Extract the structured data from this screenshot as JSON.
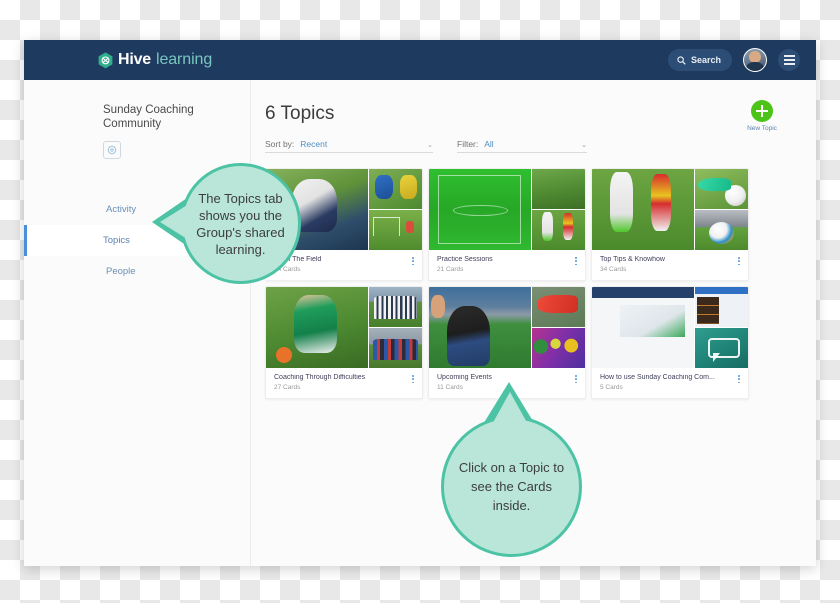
{
  "window": {
    "topbar": {
      "logo_hive": "Hive",
      "logo_learning": "learning",
      "logo_icon": "hive-hexagon-icon",
      "search_label": "Search",
      "search_icon": "search-icon",
      "avatar_name": "user-avatar",
      "menu_icon": "hamburger-menu-icon",
      "bg_color": "#1f3a5f",
      "accent_color": "#79c6c0"
    },
    "sidebar": {
      "group_name": "Sunday Coaching Community",
      "settings_icon": "gear-icon",
      "items": [
        {
          "label": "Activity",
          "active": false
        },
        {
          "label": "Topics",
          "active": true
        },
        {
          "label": "People",
          "active": false
        }
      ],
      "active_color": "#4a90d9"
    },
    "main": {
      "page_title": "6 Topics",
      "new_topic": {
        "label": "New Topic",
        "icon": "plus-icon",
        "color": "#4cc417"
      },
      "sort": {
        "label": "Sort by:",
        "value": "Recent",
        "chevron": "⌄"
      },
      "filter": {
        "label": "Filter:",
        "value": "All",
        "chevron": "⌄"
      },
      "cards": [
        {
          "title": "From The Field",
          "count": "24 Cards",
          "kebab": "more-options-icon"
        },
        {
          "title": "Practice Sessions",
          "count": "21 Cards",
          "kebab": "more-options-icon"
        },
        {
          "title": "Top Tips & Knowhow",
          "count": "34 Cards",
          "kebab": "more-options-icon"
        },
        {
          "title": "Coaching Through Difficulties",
          "count": "27 Cards",
          "kebab": "more-options-icon"
        },
        {
          "title": "Upcoming Events",
          "count": "11 Cards",
          "kebab": "more-options-icon"
        },
        {
          "title": "How to use Sunday Coaching Com...",
          "count": "5 Cards",
          "kebab": "more-options-icon"
        }
      ]
    },
    "callouts": [
      {
        "text": "The Topics tab shows you the Group's shared learning."
      },
      {
        "text": "Click on a Topic to see the Cards inside."
      }
    ],
    "callout_colors": {
      "fill": "#b9e6d8",
      "border": "#4cc3a5"
    }
  }
}
